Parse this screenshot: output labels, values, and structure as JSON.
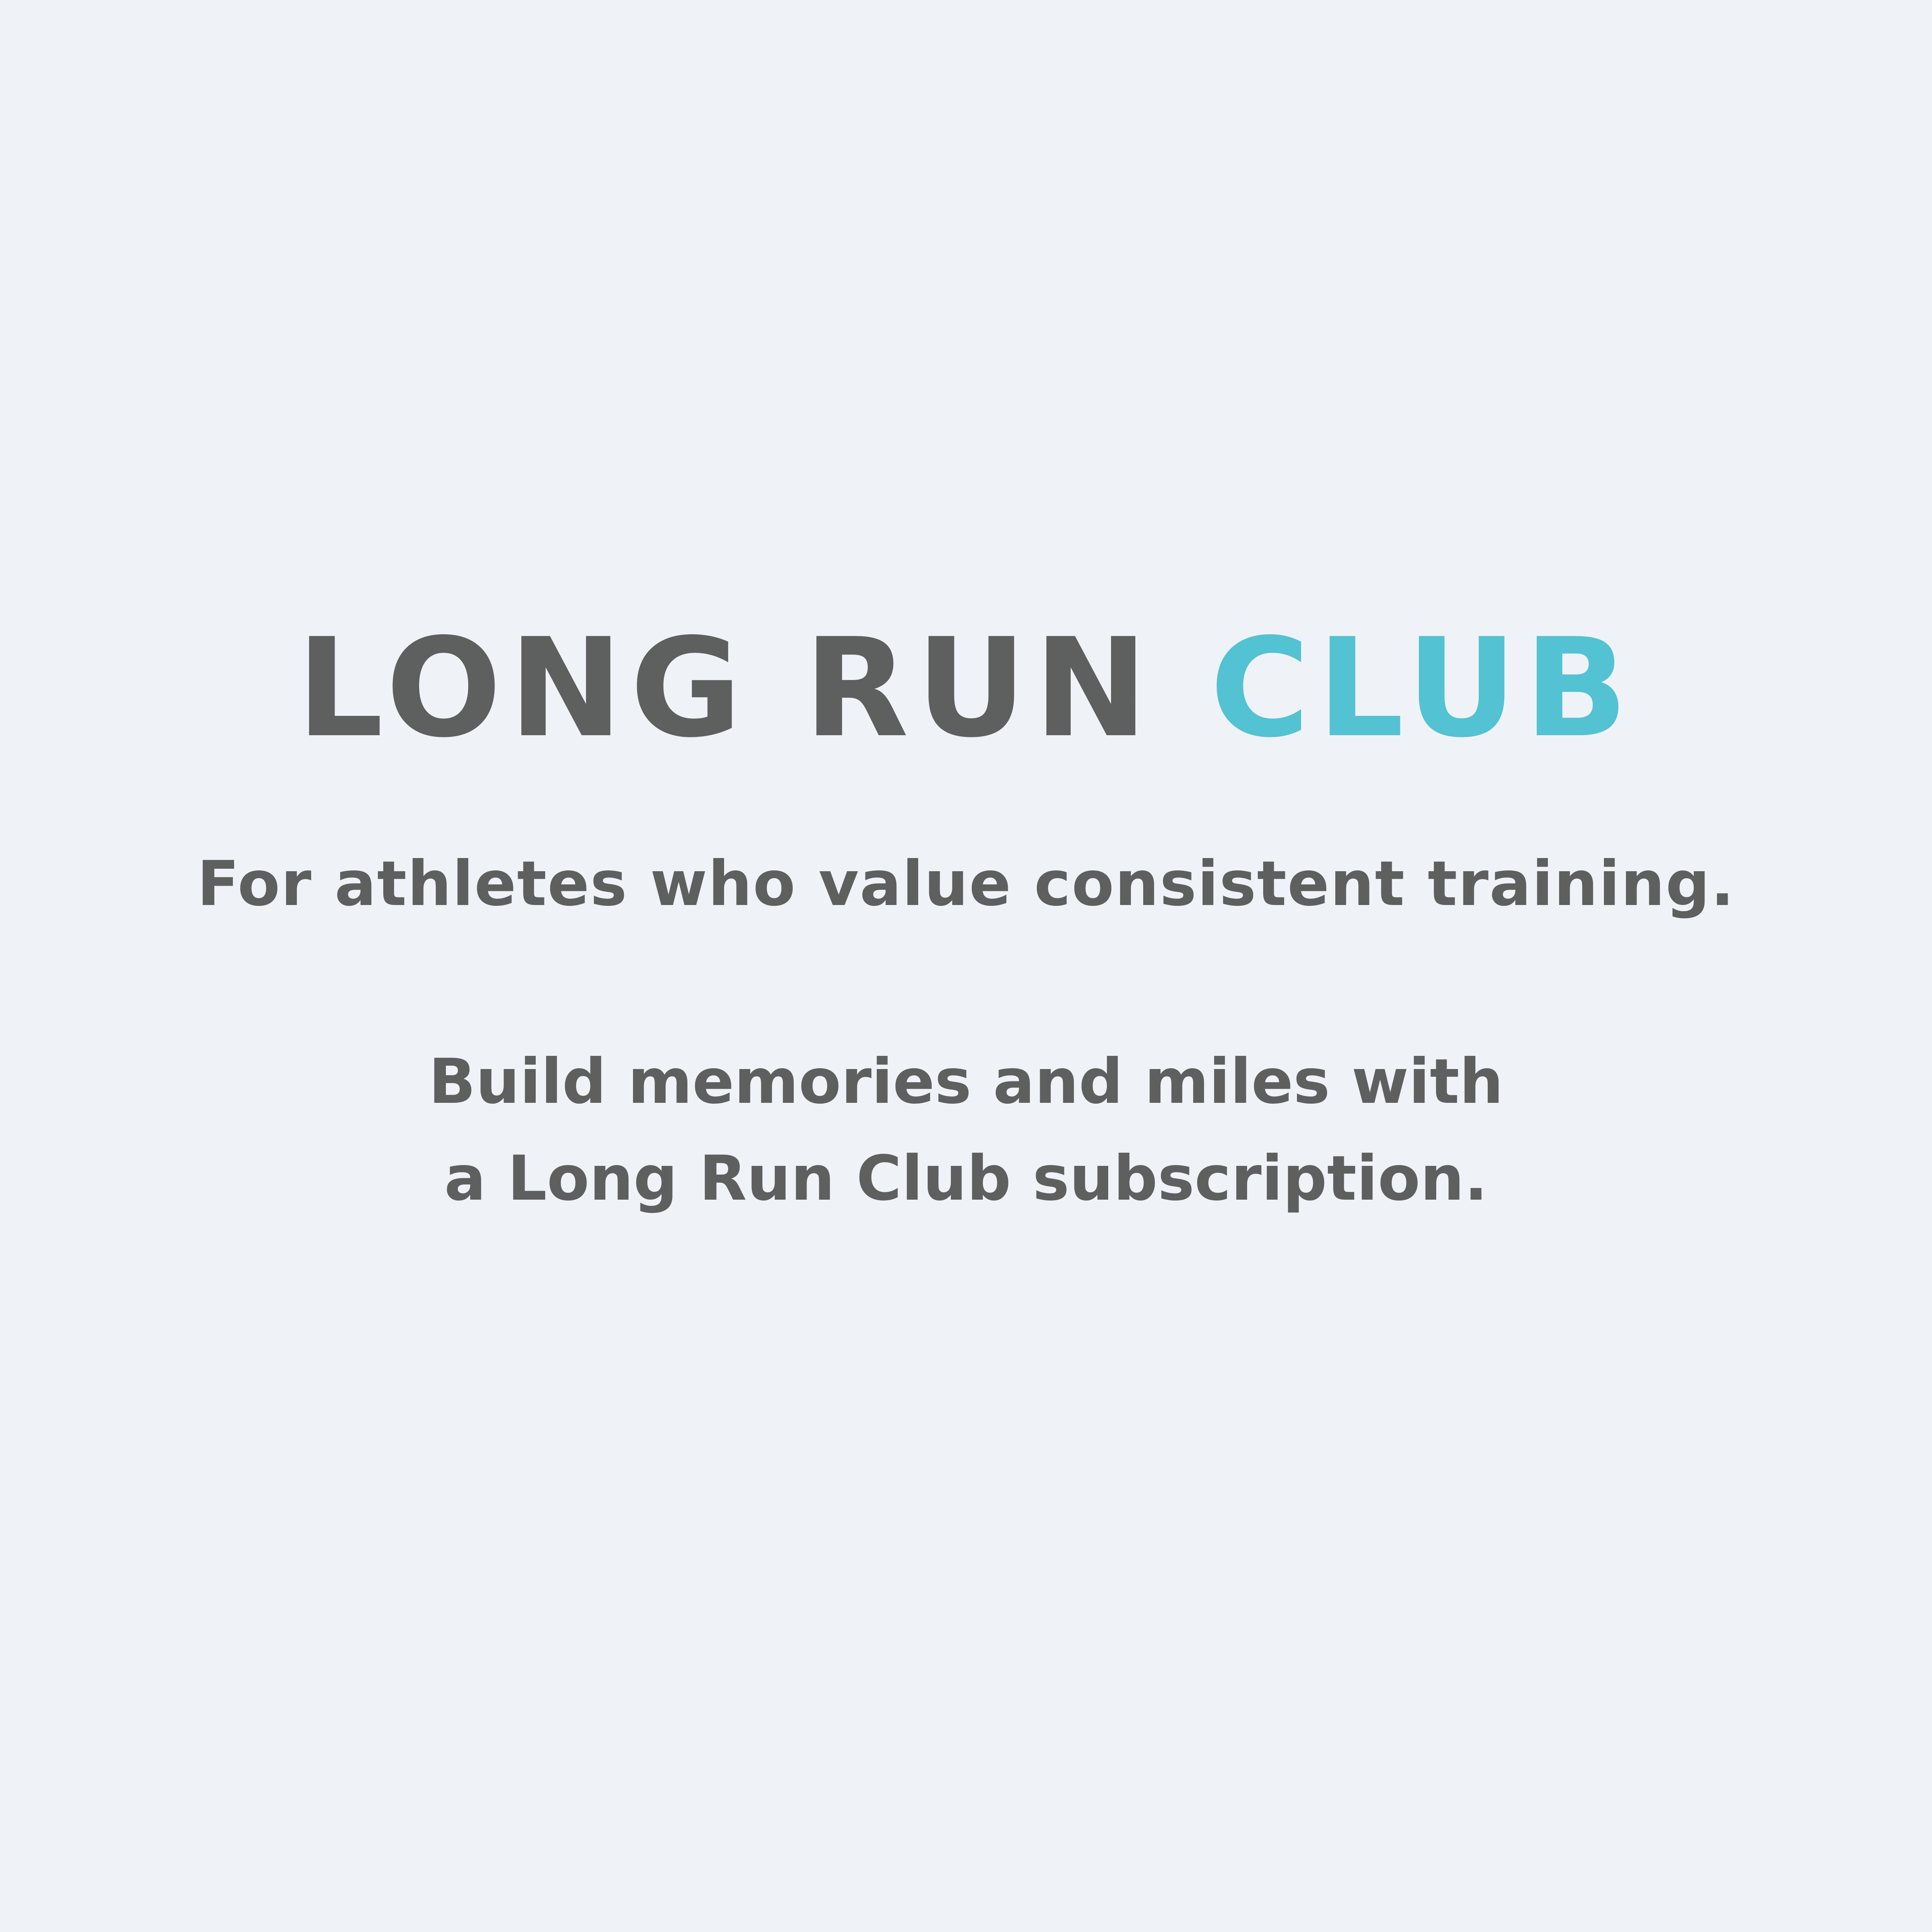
{
  "logo": {
    "word_main": "LONG RUN",
    "word_accent": "CLUB",
    "colors": {
      "main": "#5e5f5f",
      "accent": "#53c2d2"
    }
  },
  "tagline": "For athletes who value consistent training.",
  "cta": {
    "line_1": "Build memories and miles with",
    "line_2": "a Long Run Club subscription."
  },
  "background_color": "#eff3f8"
}
